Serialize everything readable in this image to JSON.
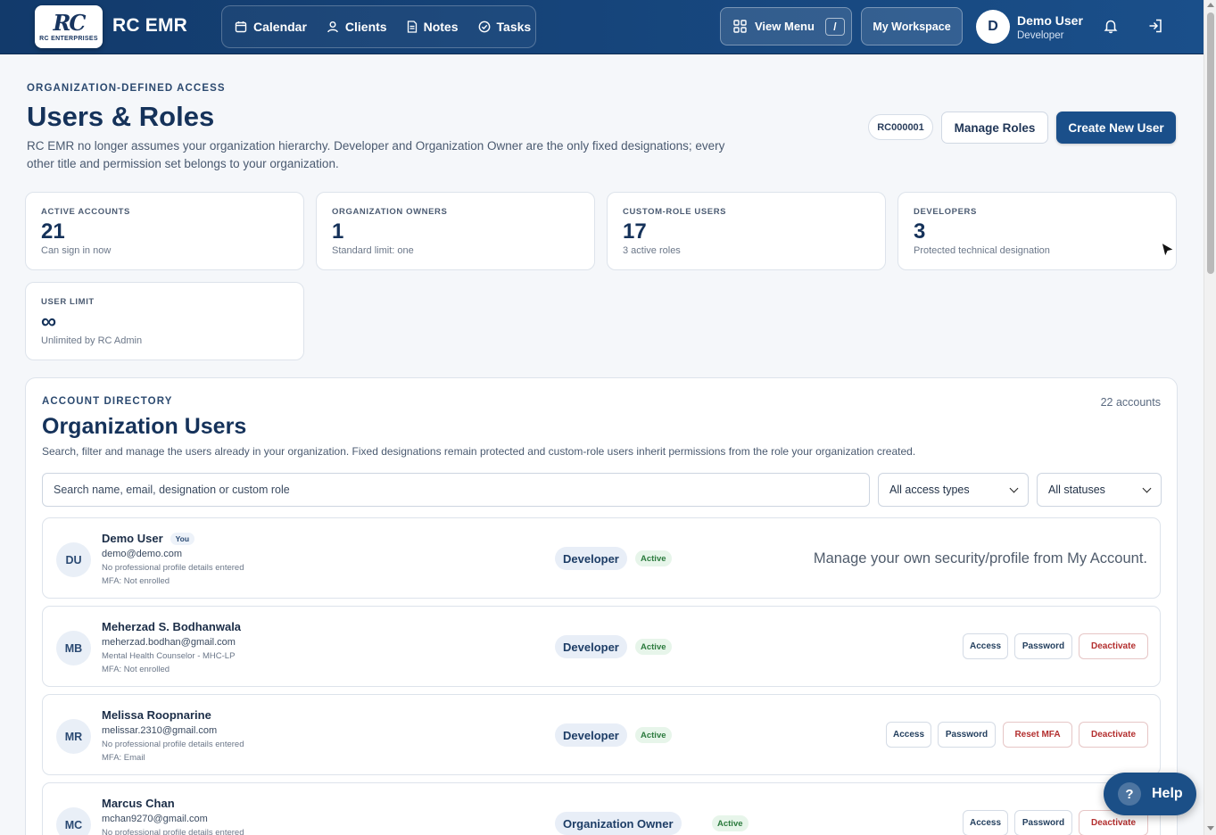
{
  "app": {
    "logo_mark": "RC",
    "logo_text": "RC ENTERPRISES",
    "name": "RC EMR"
  },
  "nav": [
    {
      "label": "Calendar",
      "icon": "calendar-icon"
    },
    {
      "label": "Clients",
      "icon": "person-icon"
    },
    {
      "label": "Notes",
      "icon": "document-icon"
    },
    {
      "label": "Tasks",
      "icon": "check-circle-icon"
    }
  ],
  "topbar": {
    "view_menu": "View Menu",
    "shortcut": "/",
    "workspace": "My Workspace",
    "avatar_initial": "D",
    "user_name": "Demo User",
    "user_role": "Developer"
  },
  "header": {
    "eyebrow": "ORGANIZATION-DEFINED ACCESS",
    "title": "Users & Roles",
    "description": "RC EMR no longer assumes your organization hierarchy. Developer and Organization Owner are the only fixed designations; every other title and permission set belongs to your organization.",
    "org_code": "RC000001",
    "manage_roles": "Manage Roles",
    "create_user": "Create New User"
  },
  "stats": [
    {
      "label": "ACTIVE ACCOUNTS",
      "value": "21",
      "sub": "Can sign in now"
    },
    {
      "label": "ORGANIZATION OWNERS",
      "value": "1",
      "sub": "Standard limit: one"
    },
    {
      "label": "CUSTOM-ROLE USERS",
      "value": "17",
      "sub": "3 active roles"
    },
    {
      "label": "DEVELOPERS",
      "value": "3",
      "sub": "Protected technical designation"
    },
    {
      "label": "USER LIMIT",
      "value": "∞",
      "sub": "Unlimited by RC Admin"
    }
  ],
  "directory": {
    "eyebrow": "ACCOUNT DIRECTORY",
    "count": "22 accounts",
    "title": "Organization Users",
    "description": "Search, filter and manage the users already in your organization. Fixed designations remain protected and custom-role users inherit permissions from the role your organization created.",
    "search_placeholder": "Search name, email, designation or custom role",
    "access_filter": "All access types",
    "status_filter": "All statuses"
  },
  "users": [
    {
      "initials": "DU",
      "name": "Demo User",
      "you_badge": "You",
      "email": "demo@demo.com",
      "profile": "No professional profile details entered",
      "mfa": "MFA: Not enrolled",
      "role": "Developer",
      "status": "Active",
      "self_note": "Manage your own security/profile from My Account."
    },
    {
      "initials": "MB",
      "name": "Meherzad S. Bodhanwala",
      "email": "meherzad.bodhan@gmail.com",
      "profile": "Mental Health Counselor - MHC-LP",
      "mfa": "MFA: Not enrolled",
      "role": "Developer",
      "status": "Active",
      "actions": [
        "Access",
        "Password",
        "Deactivate"
      ]
    },
    {
      "initials": "MR",
      "name": "Melissa Roopnarine",
      "email": "melissar.2310@gmail.com",
      "profile": "No professional profile details entered",
      "mfa": "MFA: Email",
      "role": "Developer",
      "status": "Active",
      "actions": [
        "Access",
        "Password",
        "Reset MFA",
        "Deactivate"
      ]
    },
    {
      "initials": "MC",
      "name": "Marcus Chan",
      "email": "mchan9270@gmail.com",
      "profile": "No professional profile details entered",
      "role": "Organization Owner",
      "status": "Active",
      "actions": [
        "Access",
        "Password",
        "Deactivate"
      ]
    }
  ],
  "help": {
    "label": "Help",
    "icon": "?"
  },
  "colors": {
    "primary": "#1a4f8a",
    "header_dark": "#123a6b",
    "active_green": "#2b7a3d",
    "danger": "#b32f2f"
  }
}
